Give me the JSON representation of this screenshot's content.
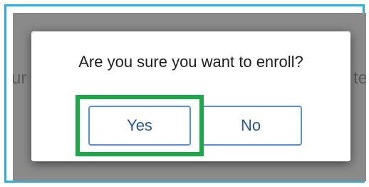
{
  "dialog": {
    "question": "Are you sure you want to enroll?",
    "yes_label": "Yes",
    "no_label": "No"
  },
  "background": {
    "left_fragment": "ur",
    "right_fragment": "te"
  },
  "colors": {
    "frame_border": "#29aee6",
    "highlight": "#1aa84b",
    "button_border": "#5b8fd6",
    "button_text": "#2b5797",
    "overlay": "#8a8a8a"
  }
}
